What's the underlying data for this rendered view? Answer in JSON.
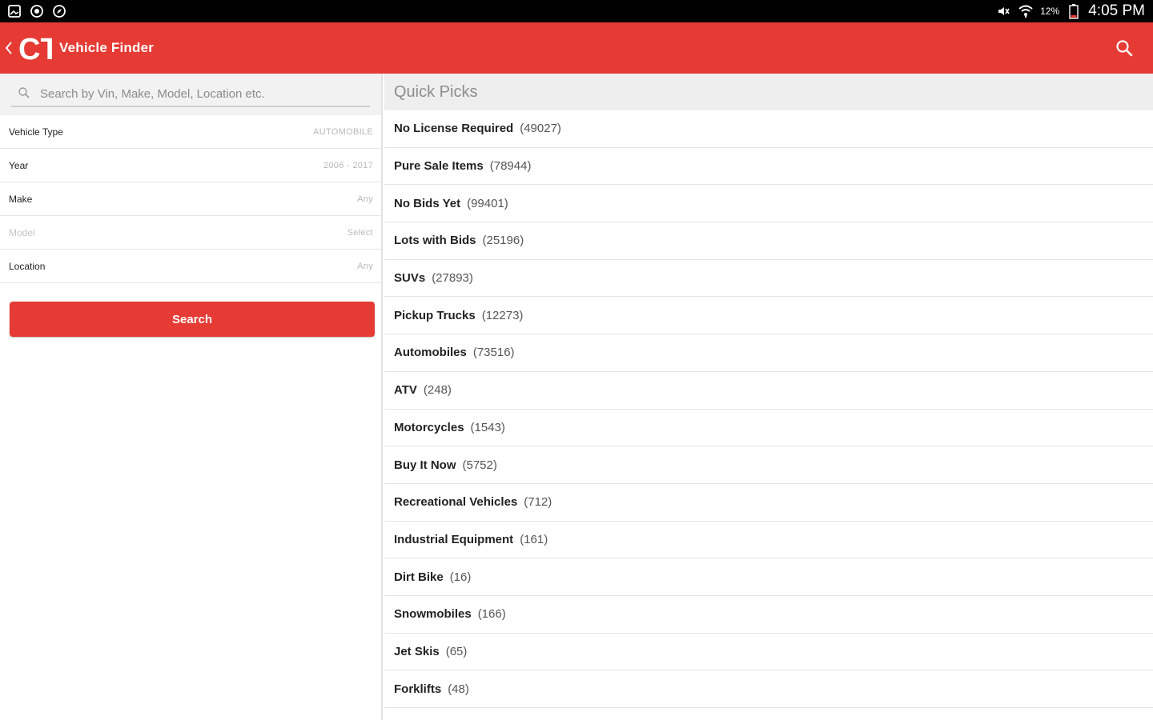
{
  "status_bar": {
    "battery_percent": "12%",
    "time": "4:05 PM",
    "icons": [
      "image-icon",
      "record-icon",
      "compass-icon",
      "mute-icon",
      "wifi-icon",
      "battery-low-icon"
    ]
  },
  "app_bar": {
    "title": "Vehicle Finder",
    "logo_text": "CT",
    "background": "#e63a34"
  },
  "filters": {
    "search_placeholder": "Search by Vin, Make, Model, Location etc.",
    "rows": [
      {
        "label": "Vehicle Type",
        "value": "AUTOMOBILE",
        "enabled": true
      },
      {
        "label": "Year",
        "value": "2006 - 2017",
        "enabled": true
      },
      {
        "label": "Make",
        "value": "Any",
        "enabled": true
      },
      {
        "label": "Model",
        "value": "Select",
        "enabled": false
      },
      {
        "label": "Location",
        "value": "Any",
        "enabled": true
      }
    ],
    "search_button": "Search"
  },
  "quick_picks": {
    "header": "Quick Picks",
    "items": [
      {
        "name": "No License Required",
        "count": "(49027)"
      },
      {
        "name": "Pure Sale Items",
        "count": "(78944)"
      },
      {
        "name": "No Bids Yet",
        "count": "(99401)"
      },
      {
        "name": "Lots with Bids",
        "count": "(25196)"
      },
      {
        "name": "SUVs",
        "count": "(27893)"
      },
      {
        "name": "Pickup Trucks",
        "count": "(12273)"
      },
      {
        "name": "Automobiles",
        "count": "(73516)"
      },
      {
        "name": "ATV",
        "count": "(248)"
      },
      {
        "name": "Motorcycles",
        "count": "(1543)"
      },
      {
        "name": "Buy It Now",
        "count": "(5752)"
      },
      {
        "name": "Recreational Vehicles",
        "count": "(712)"
      },
      {
        "name": "Industrial Equipment",
        "count": "(161)"
      },
      {
        "name": "Dirt Bike",
        "count": "(16)"
      },
      {
        "name": "Snowmobiles",
        "count": "(166)"
      },
      {
        "name": "Jet Skis",
        "count": "(65)"
      },
      {
        "name": "Forklifts",
        "count": "(48)"
      }
    ]
  }
}
